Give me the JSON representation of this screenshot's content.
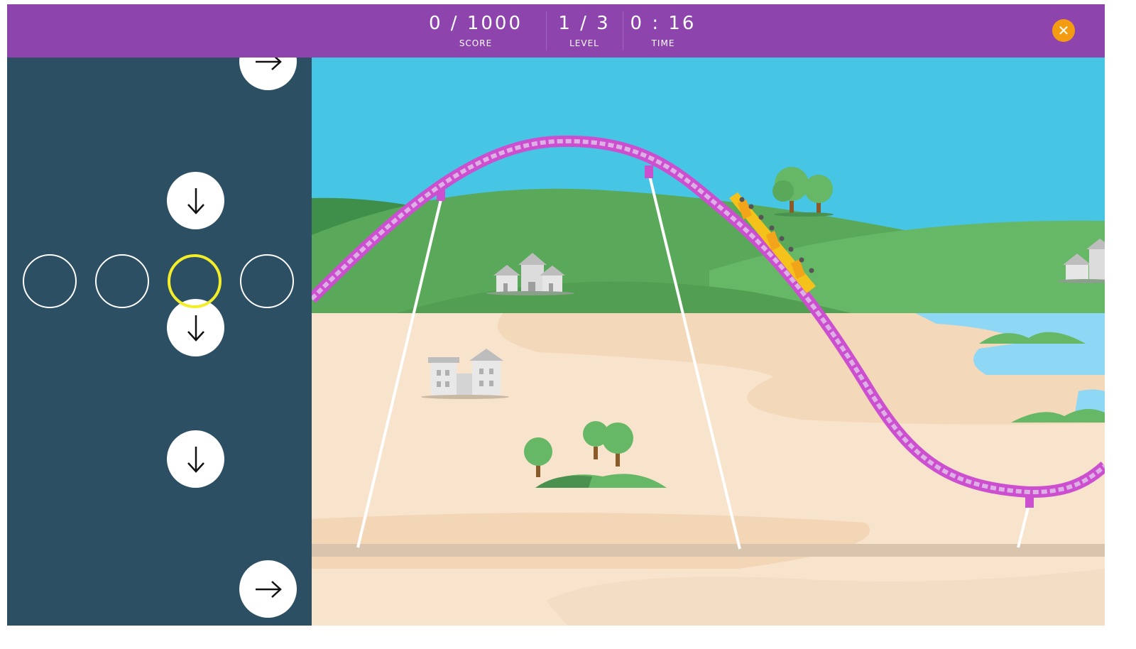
{
  "header": {
    "score": {
      "value": "0 / 1000",
      "label": "SCORE"
    },
    "level": {
      "value": "1 / 3",
      "label": "LEVEL"
    },
    "time": {
      "value": "0 : 16",
      "label": "TIME"
    },
    "close_icon": "close-icon"
  },
  "sidebar": {
    "arrows": [
      {
        "direction": "right",
        "icon": "arrow-right-icon"
      },
      {
        "direction": "down",
        "icon": "arrow-down-icon"
      },
      {
        "direction": "down",
        "icon": "arrow-down-icon"
      },
      {
        "direction": "down",
        "icon": "arrow-down-icon"
      },
      {
        "direction": "right",
        "icon": "arrow-right-icon"
      }
    ],
    "slots": {
      "count": 4,
      "active_index": 3
    }
  },
  "colors": {
    "header": "#8e44ad",
    "close_button": "#f39c12",
    "sidebar": "#2c4f63",
    "active_slot": "#f4ee2a",
    "sky": "#47c5e4",
    "track": "#cc4fcf",
    "cart": "#f5c21b",
    "sand": "#f8e3cc",
    "grass": "#5aa85a",
    "water": "#8fd8f5"
  }
}
